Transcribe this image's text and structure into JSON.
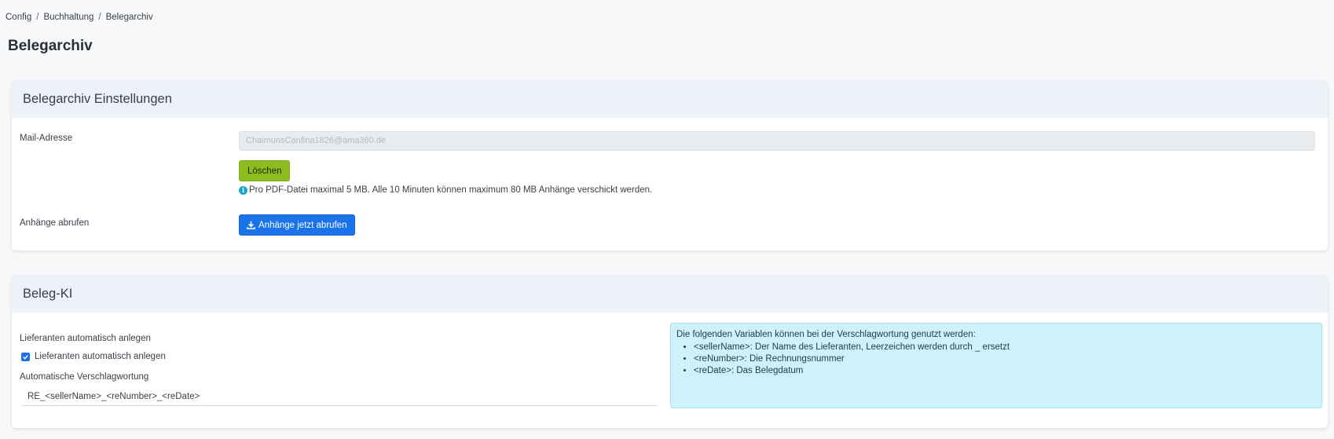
{
  "breadcrumb": {
    "items": [
      "Config",
      "Buchhaltung",
      "Belegarchiv"
    ],
    "separator": "/"
  },
  "page_title": "Belegarchiv",
  "settings_card": {
    "title": "Belegarchiv Einstellungen",
    "mail_label": "Mail-Adresse",
    "mail_value": "ChaimunsCanfina1826@ama360.de",
    "delete_button": "Löschen",
    "hint": "Pro PDF-Datei maximal 5 MB. Alle 10 Minuten können maximum 80 MB Anhänge verschickt werden.",
    "fetch_label": "Anhänge abrufen",
    "fetch_button": "Anhänge jetzt abrufen"
  },
  "ki_card": {
    "title": "Beleg-KI",
    "auto_supplier_label": "Lieferanten automatisch anlegen",
    "auto_supplier_checkbox": "Lieferanten automatisch anlegen",
    "auto_supplier_checked": true,
    "tagging_label": "Automatische Verschlagwortung",
    "tagging_value": "RE_<sellerName>_<reNumber>_<reDate>",
    "info_intro": "Die folgenden Variablen können bei der Verschlagwortung genutzt werden:",
    "variables": [
      "<sellerName>: Der Name des Lieferanten, Leerzeichen werden durch _ ersetzt",
      "<reNumber>: Die Rechnungsnummer",
      "<reDate>: Das Belegdatum"
    ]
  },
  "colors": {
    "delete_button": "#8cbd1f",
    "fetch_button": "#1a73e8",
    "info_box": "#cdf2f9",
    "card_header": "#edf1f8"
  }
}
